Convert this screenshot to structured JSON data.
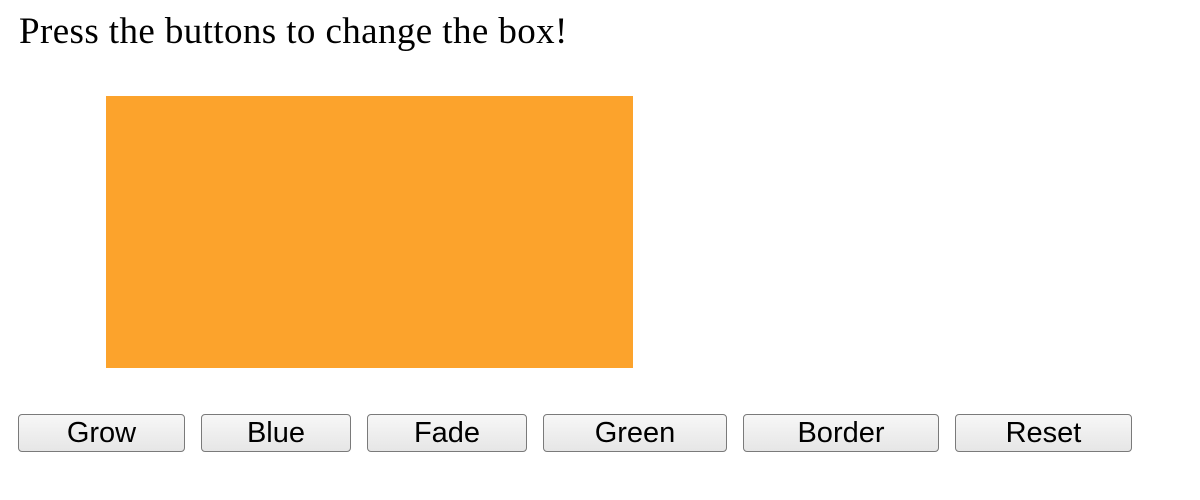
{
  "instruction": "Press the buttons to change the box!",
  "box": {
    "color": "#fca32c"
  },
  "buttons": {
    "grow": "Grow",
    "blue": "Blue",
    "fade": "Fade",
    "green": "Green",
    "border": "Border",
    "reset": "Reset"
  }
}
